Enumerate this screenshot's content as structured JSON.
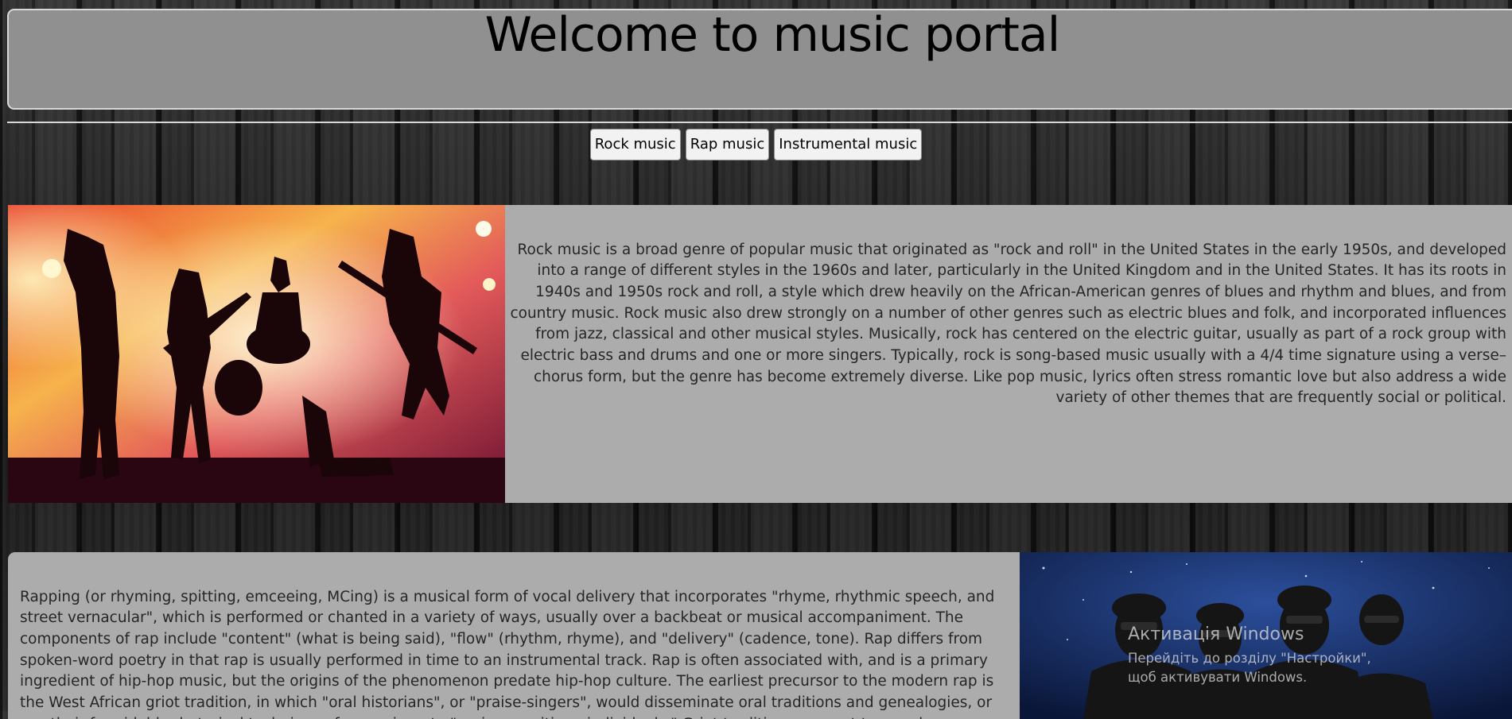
{
  "header": {
    "title": "Welcome to music portal"
  },
  "nav": {
    "buttons": [
      {
        "label": "Rock music"
      },
      {
        "label": "Rap music"
      },
      {
        "label": "Instrumental music"
      }
    ]
  },
  "sections": {
    "rock": {
      "text": "Rock music is a broad genre of popular music that originated as \"rock and roll\" in the United States in the early 1950s, and developed into a range of different styles in the 1960s and later, particularly in the United Kingdom and in the United States. It has its roots in 1940s and 1950s rock and roll, a style which drew heavily on the African-American genres of blues and rhythm and blues, and from country music. Rock music also drew strongly on a number of other genres such as electric blues and folk, and incorporated influences from jazz, classical and other musical styles. Musically, rock has centered on the electric guitar, usually as part of a rock group with electric bass and drums and one or more singers. Typically, rock is song-based music usually with a 4/4 time signature using a verse–chorus form, but the genre has become extremely diverse. Like pop music, lyrics often stress romantic love but also address a wide variety of other themes that are frequently social or political."
    },
    "rap": {
      "text": "Rapping (or rhyming, spitting, emceeing, MCing) is a musical form of vocal delivery that incorporates \"rhyme, rhythmic speech, and street vernacular\", which is performed or chanted in a variety of ways, usually over a backbeat or musical accompaniment. The components of rap include \"content\" (what is being said), \"flow\" (rhythm, rhyme), and \"delivery\" (cadence, tone). Rap differs from spoken-word poetry in that rap is usually performed in time to an instrumental track. Rap is often associated with, and is a primary ingredient of hip-hop music, but the origins of the phenomenon predate hip-hop culture. The earliest precursor to the modern rap is the West African griot tradition, in which \"oral historians\", or \"praise-singers\", would disseminate oral traditions and genealogies, or use their formidable rhetorical techniques for gossip or to \"praise or critique individuals.\" Griot traditions connect to rap along a lineage of Black verbal reverence that goes back to ancient Egyptian"
    }
  },
  "watermark": {
    "title": "Активація Windows",
    "subtitle": "Перейдіть до розділу \"Настройки\", щоб активувати Windows."
  }
}
